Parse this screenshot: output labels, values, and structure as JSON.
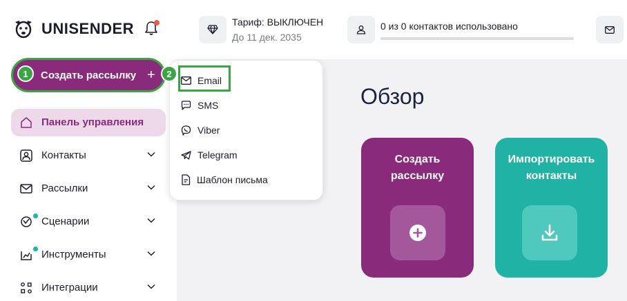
{
  "header": {
    "brand": "UNISENDER",
    "tariff_title": "Тариф: ВЫКЛЮЧЕН",
    "tariff_subtitle": "До 11 дек. 2035",
    "contacts_usage": "0 из 0 контактов использовано",
    "contacts_usage_progress": 0
  },
  "sidebar": {
    "create_button": "Создать рассылку",
    "create_button_plus": "+",
    "badge_1": "1",
    "items": [
      {
        "label": "Панель управления",
        "icon": "home-icon"
      },
      {
        "label": "Контакты",
        "icon": "contacts-icon"
      },
      {
        "label": "Рассылки",
        "icon": "mail-icon"
      },
      {
        "label": "Сценарии",
        "icon": "scenarios-icon"
      },
      {
        "label": "Инструменты",
        "icon": "tools-icon"
      },
      {
        "label": "Интеграции",
        "icon": "integrations-icon"
      }
    ]
  },
  "dropdown": {
    "badge_2": "2",
    "items": [
      {
        "label": "Email",
        "icon": "mail-icon"
      },
      {
        "label": "SMS",
        "icon": "chat-icon"
      },
      {
        "label": "Viber",
        "icon": "viber-icon"
      },
      {
        "label": "Telegram",
        "icon": "telegram-icon"
      },
      {
        "label": "Шаблон письма",
        "icon": "template-icon"
      }
    ]
  },
  "main": {
    "title": "Обзор",
    "cards": [
      {
        "title_line1": "Создать",
        "title_line2": "рассылку",
        "icon": "plus-circle-icon"
      },
      {
        "title_line1": "Импортировать",
        "title_line2": "контакты",
        "icon": "download-icon"
      }
    ]
  },
  "colors": {
    "accent": "#8a2a7a",
    "teal": "#20b3a5",
    "highlight": "#3aa545"
  }
}
